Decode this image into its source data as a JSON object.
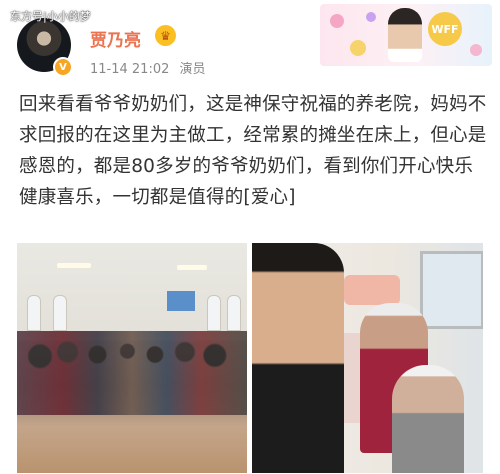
{
  "watermark": "东方号|小小的梦",
  "post": {
    "username": "贾乃亮",
    "timestamp": "11-14 21:02",
    "verified_title": "演员",
    "text": "回来看看爷爷奶奶们，这是神保守祝福的养老院，妈妈不求回报的在这里为主做工，经常累的摊坐在床上，但心是感恩的，都是80多岁的爷爷奶奶们，看到你们开心快乐健康喜乐，一切都是值得的[爱心]"
  },
  "banner": {
    "badge_text": "WFF"
  },
  "icons": {
    "verified": "verified-v-icon",
    "member": "crown-icon"
  },
  "colors": {
    "username": "#eb7350",
    "verified_badge": "#f6a623",
    "meta_text": "#888888",
    "body_text": "#333333"
  }
}
